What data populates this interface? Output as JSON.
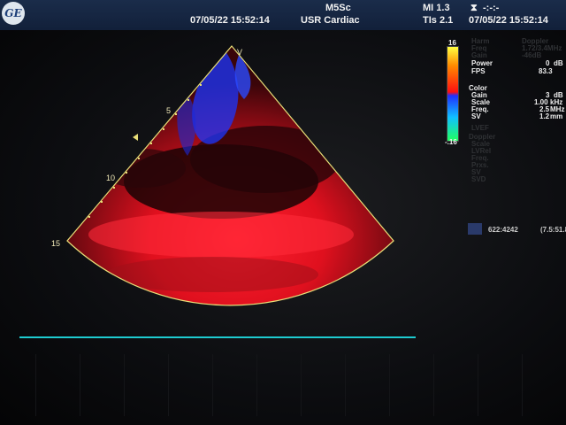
{
  "header": {
    "logo_text": "GE",
    "probe": "M5Sc",
    "preset": "USR Cardiac",
    "mi": "MI 1.3",
    "tis": "TIs 2.1",
    "datetime_left": "07/05/22 15:52:14",
    "datetime_right": "07/05/22 15:52:14",
    "hourglass_icon": "hourglass-icon",
    "timer": "-:-:-"
  },
  "image": {
    "depth_labels": [
      "5",
      "10",
      "15"
    ],
    "focus_marker": "triangle-marker",
    "probe_orientation_marker": "V"
  },
  "colorbar": {
    "max_label": "16",
    "min_label": "-.16"
  },
  "params": {
    "top_dim": [
      "Harm",
      "Freq",
      "Gain"
    ],
    "top_dim_values": [
      "Doppler",
      "1.72/3.4MHz",
      "-46dB"
    ],
    "rows": [
      {
        "label": "Power",
        "value": "0",
        "unit": "dB"
      },
      {
        "label": "FPS",
        "value": "83.3",
        "unit": ""
      }
    ],
    "color_title": "Color",
    "color_rows": [
      {
        "label": "Gain",
        "value": "3",
        "unit": "dB"
      },
      {
        "label": "Scale",
        "value": "1.00",
        "unit": "kHz"
      },
      {
        "label": "Freq.",
        "value": "2.5",
        "unit": "MHz"
      },
      {
        "label": "SV",
        "value": "1.2",
        "unit": "mm"
      }
    ],
    "dim_rows": [
      "LVEF",
      "Doppler",
      "Scale",
      "LVRel",
      "Freq.",
      "Prxs.",
      "SV",
      "SVD"
    ],
    "measure": "622:4242",
    "measure2": "(7.5:51.8"
  }
}
